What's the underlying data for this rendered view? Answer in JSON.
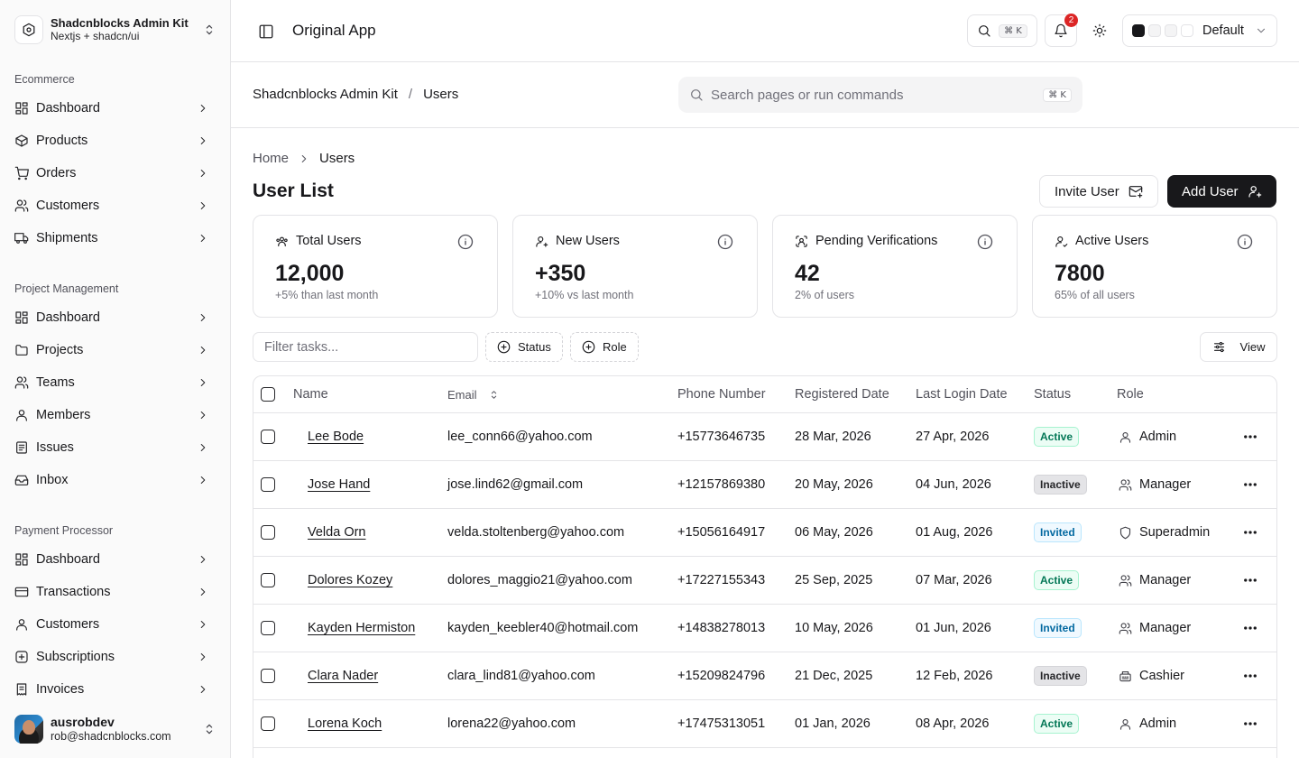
{
  "team": {
    "name": "Shadcnblocks Admin Kit",
    "subtitle": "Nextjs + shadcn/ui"
  },
  "sidebar": {
    "groups": [
      {
        "label": "Ecommerce",
        "items": [
          "Dashboard",
          "Products",
          "Orders",
          "Customers",
          "Shipments"
        ]
      },
      {
        "label": "Project Management",
        "items": [
          "Dashboard",
          "Projects",
          "Teams",
          "Members",
          "Issues",
          "Inbox"
        ]
      },
      {
        "label": "Payment Processor",
        "items": [
          "Dashboard",
          "Transactions",
          "Customers",
          "Subscriptions",
          "Invoices"
        ]
      }
    ]
  },
  "user": {
    "name": "ausrobdev",
    "email": "rob@shadcnblocks.com"
  },
  "topbar": {
    "title": "Original App",
    "search_kbd": "⌘ K",
    "notif_count": "2",
    "theme_label": "Default"
  },
  "subheader": {
    "crumb_root": "Shadcnblocks Admin Kit",
    "crumb_sep": "/",
    "crumb_current": "Users",
    "search_placeholder": "Search pages or run commands",
    "search_kbd": "⌘ K"
  },
  "page": {
    "breadcrumb_home": "Home",
    "breadcrumb_current": "Users",
    "title": "User List",
    "invite_label": "Invite User",
    "add_label": "Add User"
  },
  "stats": [
    {
      "label": "Total Users",
      "value": "12,000",
      "sub": "+5% than last month"
    },
    {
      "label": "New Users",
      "value": "+350",
      "sub": "+10% vs last month"
    },
    {
      "label": "Pending Verifications",
      "value": "42",
      "sub": "2% of users"
    },
    {
      "label": "Active Users",
      "value": "7800",
      "sub": "65% of all users"
    }
  ],
  "toolbar": {
    "filter_placeholder": "Filter tasks...",
    "status_label": "Status",
    "role_label": "Role",
    "view_label": "View"
  },
  "table": {
    "headers": {
      "name": "Name",
      "email": "Email",
      "phone": "Phone Number",
      "registered": "Registered Date",
      "last_login": "Last Login Date",
      "status": "Status",
      "role": "Role"
    },
    "rows": [
      {
        "name": "Lee Bode",
        "email": "lee_conn66@yahoo.com",
        "phone": "+15773646735",
        "registered": "28 Mar, 2026",
        "last_login": "27 Apr, 2026",
        "status": "Active",
        "role": "Admin"
      },
      {
        "name": "Jose Hand",
        "email": "jose.lind62@gmail.com",
        "phone": "+12157869380",
        "registered": "20 May, 2026",
        "last_login": "04 Jun, 2026",
        "status": "Inactive",
        "role": "Manager"
      },
      {
        "name": "Velda Orn",
        "email": "velda.stoltenberg@yahoo.com",
        "phone": "+15056164917",
        "registered": "06 May, 2026",
        "last_login": "01 Aug, 2026",
        "status": "Invited",
        "role": "Superadmin"
      },
      {
        "name": "Dolores Kozey",
        "email": "dolores_maggio21@yahoo.com",
        "phone": "+17227155343",
        "registered": "25 Sep, 2025",
        "last_login": "07 Mar, 2026",
        "status": "Active",
        "role": "Manager"
      },
      {
        "name": "Kayden Hermiston",
        "email": "kayden_keebler40@hotmail.com",
        "phone": "+14838278013",
        "registered": "10 May, 2026",
        "last_login": "01 Jun, 2026",
        "status": "Invited",
        "role": "Manager"
      },
      {
        "name": "Clara Nader",
        "email": "clara_lind81@yahoo.com",
        "phone": "+15209824796",
        "registered": "21 Dec, 2025",
        "last_login": "12 Feb, 2026",
        "status": "Inactive",
        "role": "Cashier"
      },
      {
        "name": "Lorena Koch",
        "email": "lorena22@yahoo.com",
        "phone": "+17475313051",
        "registered": "01 Jan, 2026",
        "last_login": "08 Apr, 2026",
        "status": "Active",
        "role": "Admin"
      }
    ]
  }
}
